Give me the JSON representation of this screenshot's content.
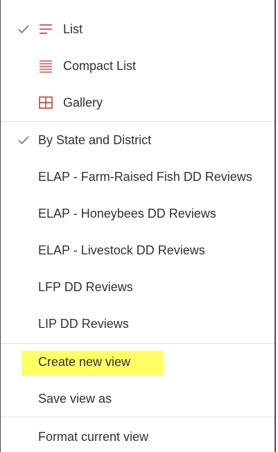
{
  "menu": {
    "layouts": [
      {
        "label": "List",
        "checked": true,
        "icon": "list-icon"
      },
      {
        "label": "Compact List",
        "checked": false,
        "icon": "compact-list-icon"
      },
      {
        "label": "Gallery",
        "checked": false,
        "icon": "gallery-icon"
      }
    ],
    "views": [
      {
        "label": "By State and District",
        "checked": true
      },
      {
        "label": "ELAP - Farm-Raised Fish DD Reviews",
        "checked": false
      },
      {
        "label": "ELAP - Honeybees DD Reviews",
        "checked": false
      },
      {
        "label": "ELAP - Livestock DD Reviews",
        "checked": false
      },
      {
        "label": "LFP DD Reviews",
        "checked": false
      },
      {
        "label": "LIP DD Reviews",
        "checked": false
      }
    ],
    "actions": [
      {
        "label": "Create new view",
        "highlighted": true
      },
      {
        "label": "Save view as",
        "highlighted": false
      }
    ],
    "format": {
      "label": "Format current view"
    }
  },
  "colors": {
    "accent": "#c4312b",
    "text": "#323130",
    "highlight": "#ffff66",
    "divider": "#dcdcdc"
  }
}
